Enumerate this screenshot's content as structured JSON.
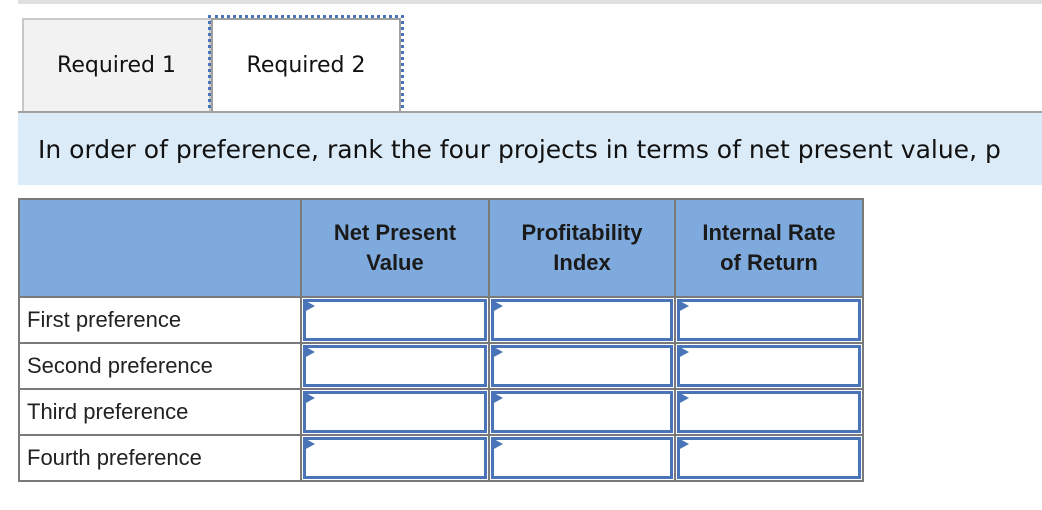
{
  "tabs": [
    {
      "label": "Required 1",
      "active": false
    },
    {
      "label": "Required 2",
      "active": true
    }
  ],
  "instruction": "In order of preference, rank the four projects in terms of net present value, p",
  "table": {
    "columns": [
      "Net Present Value",
      "Profitability Index",
      "Internal Rate of Return"
    ],
    "column_lines": [
      [
        "Net Present",
        "Value"
      ],
      [
        "Profitability",
        "Index"
      ],
      [
        "Internal Rate",
        "of Return"
      ]
    ],
    "rows": [
      {
        "label": "First preference",
        "values": [
          "",
          "",
          ""
        ]
      },
      {
        "label": "Second preference",
        "values": [
          "",
          "",
          ""
        ]
      },
      {
        "label": "Third preference",
        "values": [
          "",
          "",
          ""
        ]
      },
      {
        "label": "Fourth preference",
        "values": [
          "",
          "",
          ""
        ]
      }
    ],
    "cell_icon": "dropdown-flag-icon"
  },
  "colors": {
    "accent": "#4a74b8",
    "header_bg": "#7faadd",
    "instruction_bg": "#dcebf8"
  }
}
